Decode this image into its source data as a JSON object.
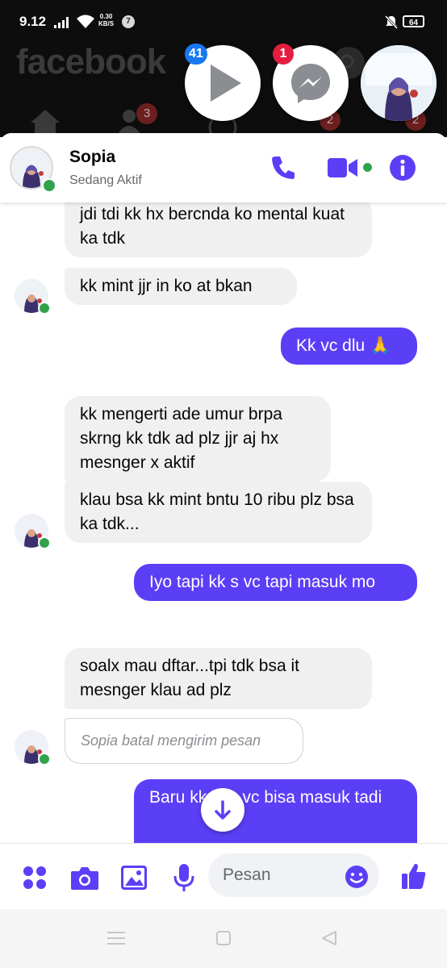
{
  "status_bar": {
    "time": "9.12",
    "net_speed_value": "0.30",
    "net_speed_unit": "KB/S",
    "notification_count": "7",
    "battery": "64"
  },
  "facebook": {
    "logo_text": "facebook",
    "friends_badge": "3",
    "badge_right_1": "2",
    "badge_right_2": "2"
  },
  "chat_heads": {
    "video_badge": "41",
    "messenger_badge": "1"
  },
  "chat": {
    "contact_name": "Sopia",
    "contact_status": "Sedang Aktif",
    "accent": "#5b3ff6",
    "active_color": "#31a24c",
    "messages": [
      {
        "side": "in",
        "text": "jdi tdi kk hx bercnda ko mental kuat ka tdk"
      },
      {
        "side": "in",
        "text": "kk mint jjr in ko at bkan"
      },
      {
        "side": "out",
        "text": "Kk vc dlu 🙏"
      },
      {
        "side": "in",
        "text": "kk mengerti ade umur brpa skrng kk tdk ad plz jjr aj hx mesnger x aktif"
      },
      {
        "side": "in",
        "text": "klau bsa kk mint bntu 10 ribu plz bsa ka tdk..."
      },
      {
        "side": "out",
        "text": "Iyo tapi kk s vc tapi masuk mo"
      },
      {
        "side": "in",
        "text": "soalx mau dftar...tpi tdk bsa it mesnger klau ad plz"
      },
      {
        "side": "in",
        "text": "Sopia batal mengirim pesan",
        "retracted": true
      },
      {
        "side": "out",
        "text": "Baru kk ja s vc bisa masuk tadi"
      }
    ]
  },
  "composer": {
    "placeholder": "Pesan"
  }
}
